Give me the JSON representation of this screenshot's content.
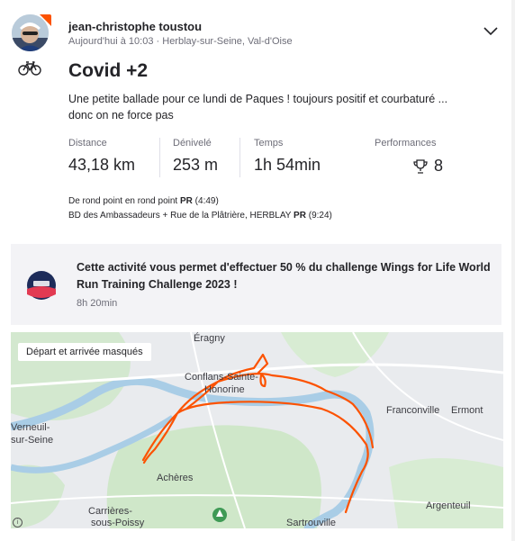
{
  "header": {
    "athlete_name": "jean-christophe toustou",
    "timestamp": "Aujourd'hui à 10:03",
    "separator": "·",
    "location": "Herblay-sur-Seine, Val-d'Oise",
    "sport_icon": "bike-icon",
    "menu_icon": "chevron-down-icon"
  },
  "activity": {
    "title": "Covid +2",
    "description": "Une petite ballade pour ce lundi de Paques ! toujours positif et courbaturé ... donc on ne force pas"
  },
  "stats": [
    {
      "label": "Distance",
      "value": "43,18 km"
    },
    {
      "label": "Dénivelé",
      "value": "253 m"
    },
    {
      "label": "Temps",
      "value": "1h 54min"
    }
  ],
  "performances": {
    "label": "Performances",
    "count": "8",
    "icon": "trophy-icon"
  },
  "segments": [
    {
      "name": "De rond point en rond point",
      "pr": "PR",
      "time": "(4:49)"
    },
    {
      "name": "BD des Ambassadeurs + Rue de la Plâtrière, HERBLAY",
      "pr": "PR",
      "time": "(9:24)"
    }
  ],
  "challenge": {
    "text": "Cette activité vous permet d'effectuer 50 % du challenge Wings for Life World Run Training Challenge 2023 !",
    "duration": "8h 20min",
    "badge_icon": "challenge-badge-icon"
  },
  "map": {
    "badge": "Départ et arrivée masqués",
    "labels": [
      "Éragny",
      "Conflans-Sainte-",
      "Honorine",
      "Franconville",
      "Ermont",
      "Verneuil-",
      "sur-Seine",
      "Achères",
      "Carrières-",
      "sous-Poissy",
      "Sartrouville",
      "Argenteuil"
    ],
    "route_color": "#fc5200",
    "river_color": "#a9cde6",
    "park_color": "#cfe7c9"
  },
  "colors": {
    "accent": "#fc5200",
    "text": "#242428",
    "muted": "#6d6d78"
  }
}
